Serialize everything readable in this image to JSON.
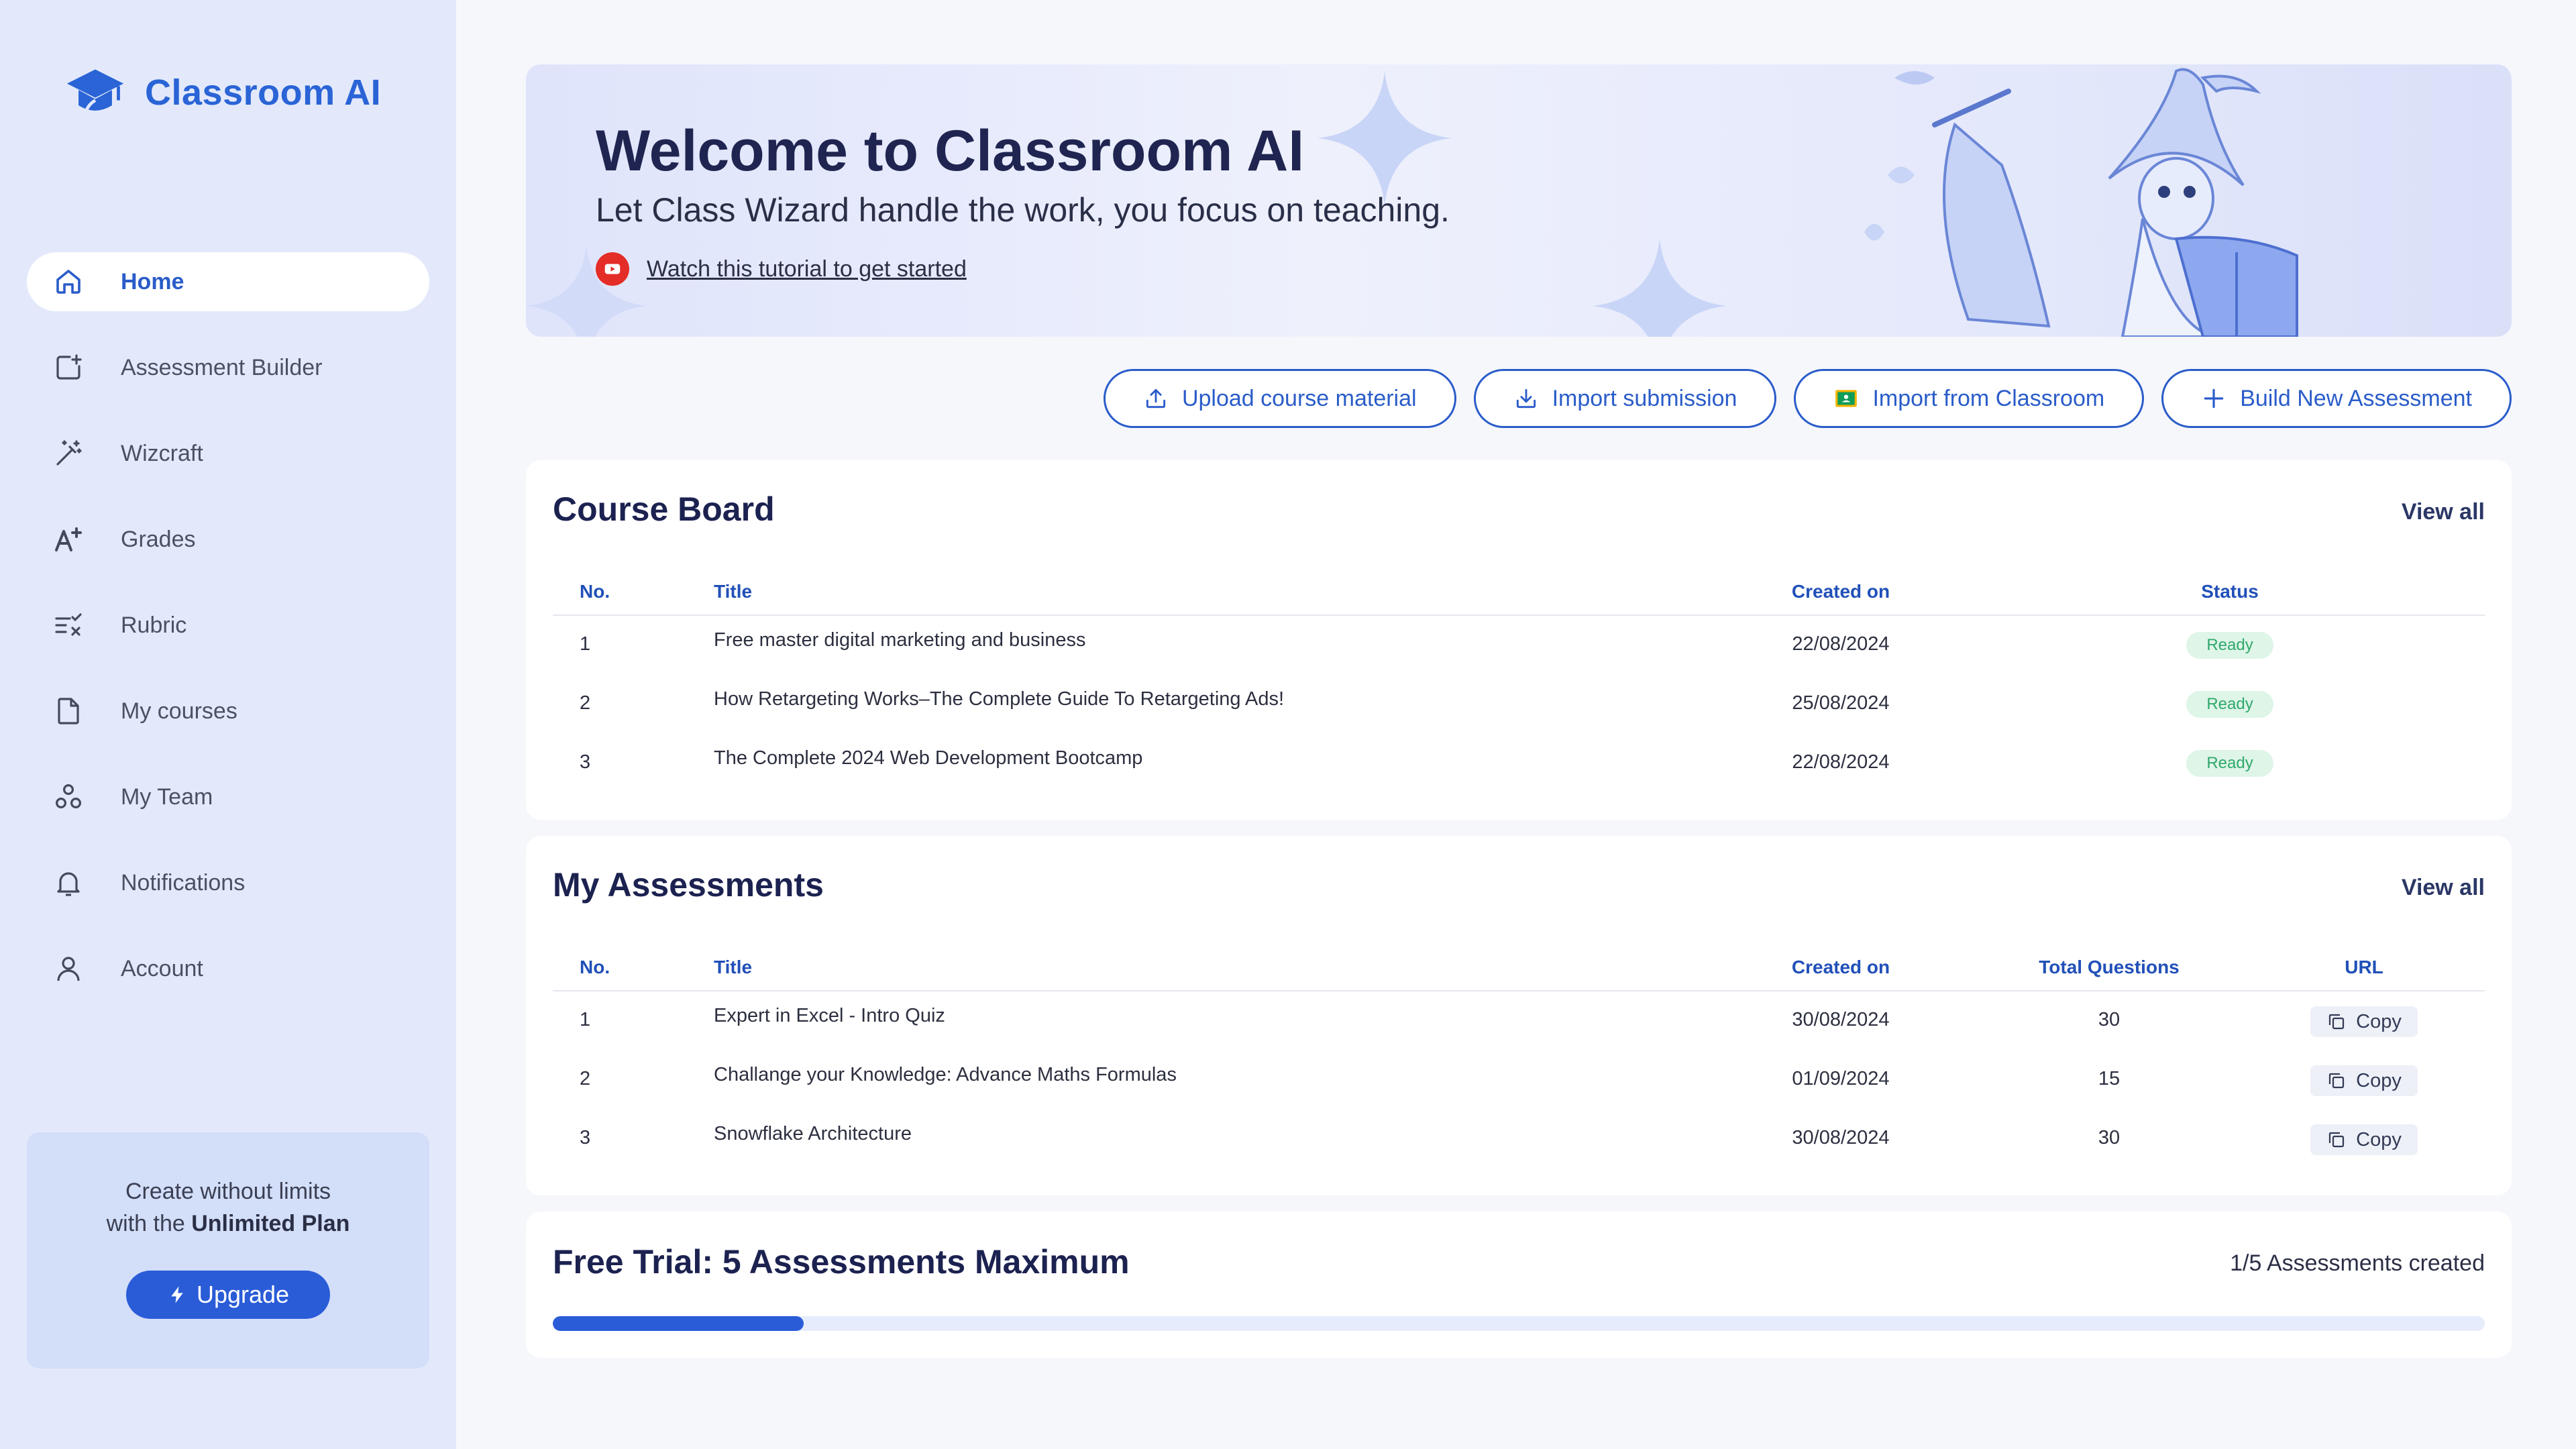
{
  "app": {
    "name": "Classroom AI"
  },
  "sidebar": {
    "items": [
      {
        "label": "Home",
        "icon": "home-icon",
        "active": true
      },
      {
        "label": "Assessment Builder",
        "icon": "add-square-icon"
      },
      {
        "label": "Wizcraft",
        "icon": "magic-wand-icon"
      },
      {
        "label": "Grades",
        "icon": "a-plus-icon"
      },
      {
        "label": "Rubric",
        "icon": "rubric-list-icon"
      },
      {
        "label": "My courses",
        "icon": "document-icon"
      },
      {
        "label": "My Team",
        "icon": "team-icon"
      },
      {
        "label": "Notifications",
        "icon": "bell-icon"
      },
      {
        "label": "Account",
        "icon": "user-icon"
      }
    ],
    "upgrade": {
      "line1": "Create without limits",
      "line2_prefix": "with the ",
      "line2_bold": "Unlimited Plan",
      "button": "Upgrade"
    }
  },
  "banner": {
    "title": "Welcome to Classroom AI",
    "subtitle": "Let Class Wizard handle the work, you focus on teaching.",
    "tutorial_link": "Watch this tutorial to get started"
  },
  "actions": {
    "upload": "Upload course material",
    "import_submission": "Import submission",
    "import_classroom": "Import from Classroom",
    "build": "Build New Assessment"
  },
  "course_board": {
    "title": "Course Board",
    "view_all": "View all",
    "columns": {
      "no": "No.",
      "title": "Title",
      "created": "Created on",
      "status": "Status"
    },
    "rows": [
      {
        "no": "1",
        "title": "Free master digital marketing and business",
        "created": "22/08/2024",
        "status": "Ready"
      },
      {
        "no": "2",
        "title": "How Retargeting Works–The Complete Guide To Retargeting Ads!",
        "created": "25/08/2024",
        "status": "Ready"
      },
      {
        "no": "3",
        "title": "The Complete 2024 Web Development Bootcamp",
        "created": "22/08/2024",
        "status": "Ready"
      }
    ]
  },
  "assessments": {
    "title": "My Assessments",
    "view_all": "View all",
    "columns": {
      "no": "No.",
      "title": "Title",
      "created": "Created on",
      "questions": "Total Questions",
      "url": "URL"
    },
    "copy_label": "Copy",
    "rows": [
      {
        "no": "1",
        "title": "Expert in Excel - Intro Quiz",
        "created": "30/08/2024",
        "questions": "30"
      },
      {
        "no": "2",
        "title": "Challange your Knowledge: Advance Maths Formulas",
        "created": "01/09/2024",
        "questions": "15"
      },
      {
        "no": "3",
        "title": "Snowflake Architecture",
        "created": "30/08/2024",
        "questions": "30"
      }
    ]
  },
  "trial": {
    "title": "Free Trial: 5 Assessments Maximum",
    "count_text": "1/5 Assessments created",
    "progress_fraction": 0.13
  },
  "colors": {
    "accent": "#2a5cd8",
    "sidebar_bg": "#e3e9fb",
    "status_ready_bg": "#def5e8",
    "status_ready_text": "#2fa86b"
  }
}
